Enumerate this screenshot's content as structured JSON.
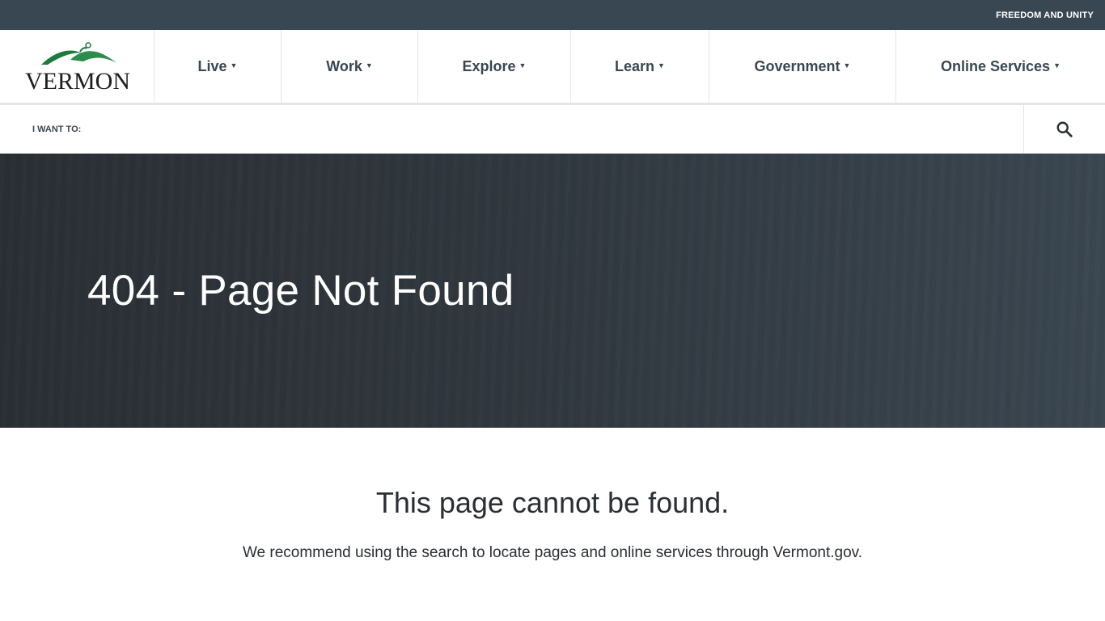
{
  "topbar": {
    "motto": "FREEDOM AND UNITY"
  },
  "logo": {
    "text": "VERMONT",
    "mark_color": "#1b7a3e"
  },
  "nav": {
    "items": [
      {
        "label": "Live"
      },
      {
        "label": "Work"
      },
      {
        "label": "Explore"
      },
      {
        "label": "Learn"
      },
      {
        "label": "Government"
      },
      {
        "label": "Online Services"
      }
    ]
  },
  "iwant": {
    "label": "I WANT TO:",
    "search_icon": "search-icon"
  },
  "hero": {
    "title": "404 - Page Not Found"
  },
  "content": {
    "heading": "This page cannot be found.",
    "message": "We recommend using the search to locate pages and online services through Vermont.gov."
  },
  "colors": {
    "topbar": "#394753",
    "nav_text": "#394753",
    "hero_dark": "#2a2f34"
  }
}
